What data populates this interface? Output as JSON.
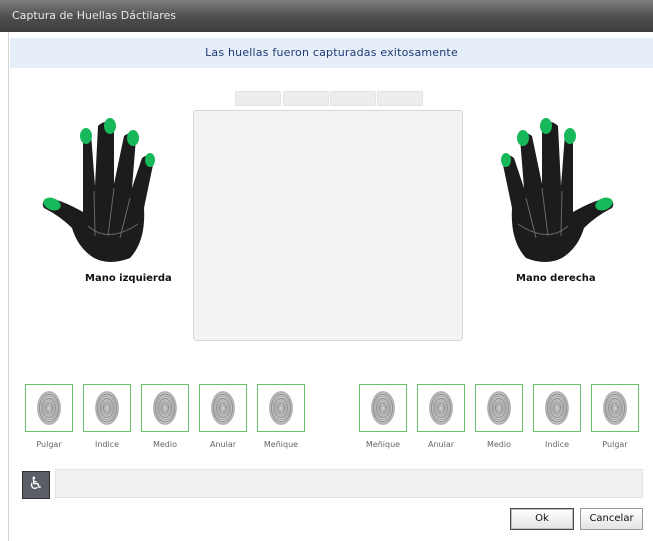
{
  "window": {
    "title": "Captura de Huellas Dáctilares"
  },
  "banner": {
    "message": "Las huellas fueron capturadas exitosamente"
  },
  "capture": {
    "tabs": [
      "",
      "",
      "",
      ""
    ]
  },
  "hands": {
    "left": {
      "label": "Mano izquierda"
    },
    "right": {
      "label": "Mano derecha"
    }
  },
  "fingerprints": {
    "left": [
      {
        "label": "Pulgar",
        "captured": true
      },
      {
        "label": "Indice",
        "captured": true
      },
      {
        "label": "Medio",
        "captured": true
      },
      {
        "label": "Anular",
        "captured": true
      },
      {
        "label": "Meñique",
        "captured": true
      }
    ],
    "right": [
      {
        "label": "Meñique",
        "captured": true
      },
      {
        "label": "Anular",
        "captured": true
      },
      {
        "label": "Medio",
        "captured": true
      },
      {
        "label": "Indice",
        "captured": true
      },
      {
        "label": "Pulgar",
        "captured": true
      }
    ]
  },
  "accessibility": {
    "icon": "wheelchair-icon",
    "glyph": "♿"
  },
  "buttons": {
    "ok": "Ok",
    "cancel": "Cancelar"
  },
  "colors": {
    "captured_finger": "#16b85a",
    "hand": "#1c1c1c",
    "thumb_border": "#6cc36c",
    "banner_text": "#1f3a74"
  }
}
